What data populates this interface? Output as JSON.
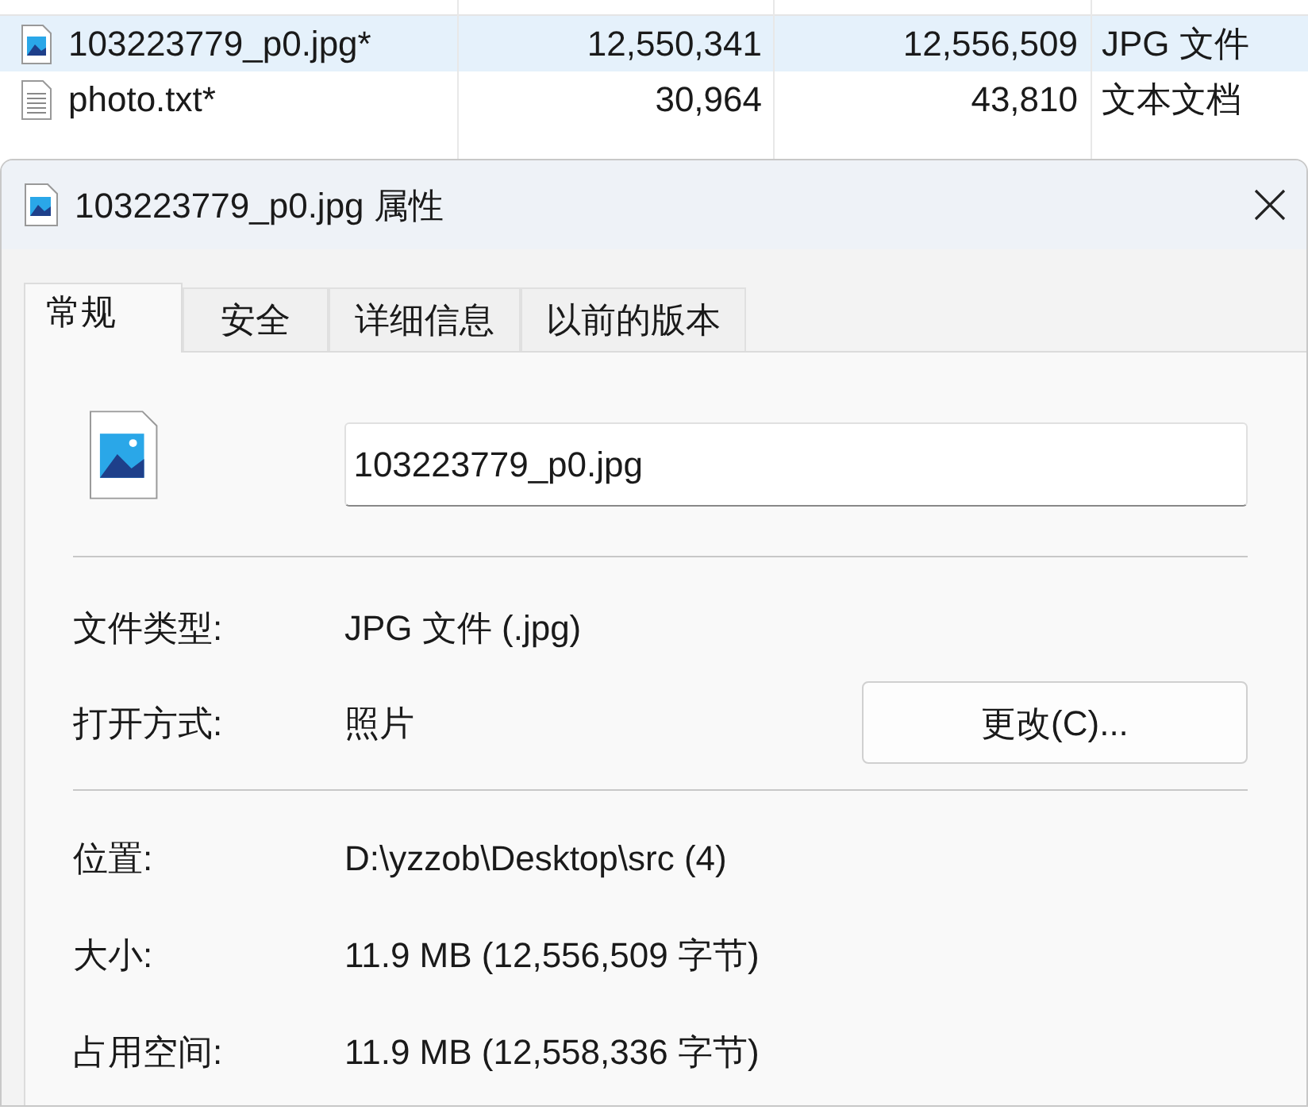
{
  "file_list": {
    "rows": [
      {
        "kind": "image",
        "name": "103223779_p0.jpg*",
        "compressed": "12,550,341",
        "original": "12,556,509",
        "type": "JPG 文件",
        "selected": true
      },
      {
        "kind": "text",
        "name": "photo.txt*",
        "compressed": "30,964",
        "original": "43,810",
        "type": "文本文档",
        "selected": false
      }
    ]
  },
  "dialog": {
    "title": "103223779_p0.jpg 属性",
    "tabs": [
      {
        "label": "常规",
        "selected": true
      },
      {
        "label": "安全",
        "selected": false
      },
      {
        "label": "详细信息",
        "selected": false
      },
      {
        "label": "以前的版本",
        "selected": false
      }
    ],
    "file_name": "103223779_p0.jpg",
    "group_1": [
      {
        "label": "文件类型:",
        "value": "JPG 文件 (.jpg)"
      },
      {
        "label": "打开方式:",
        "value": "照片",
        "button": "更改(C)..."
      }
    ],
    "group_2": [
      {
        "label": "位置:",
        "value": "D:\\yzzob\\Desktop\\src (4)"
      },
      {
        "label": "大小:",
        "value": "11.9 MB (12,556,509 字节)"
      },
      {
        "label": "占用空间:",
        "value": "11.9 MB (12,558,336 字节)"
      }
    ]
  }
}
